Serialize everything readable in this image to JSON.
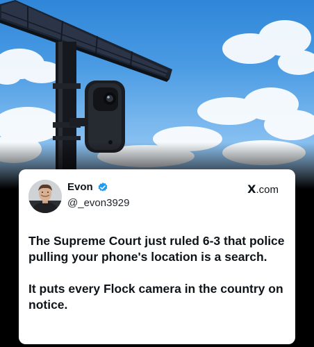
{
  "photo": {
    "subject": "solar-camera-pole",
    "sky_color": "#4a9be3"
  },
  "tweet": {
    "author": {
      "display_name": "Evon",
      "handle": "@_evon3929",
      "verified_icon": "verified-badge-icon",
      "verified_color": "#1d9bf0"
    },
    "source_prefix": "X",
    "source_suffix": ".com",
    "paragraphs": [
      "The Supreme Court just ruled 6-3 that police pulling your phone's location is a search.",
      "It puts every Flock camera in the country on notice."
    ]
  }
}
